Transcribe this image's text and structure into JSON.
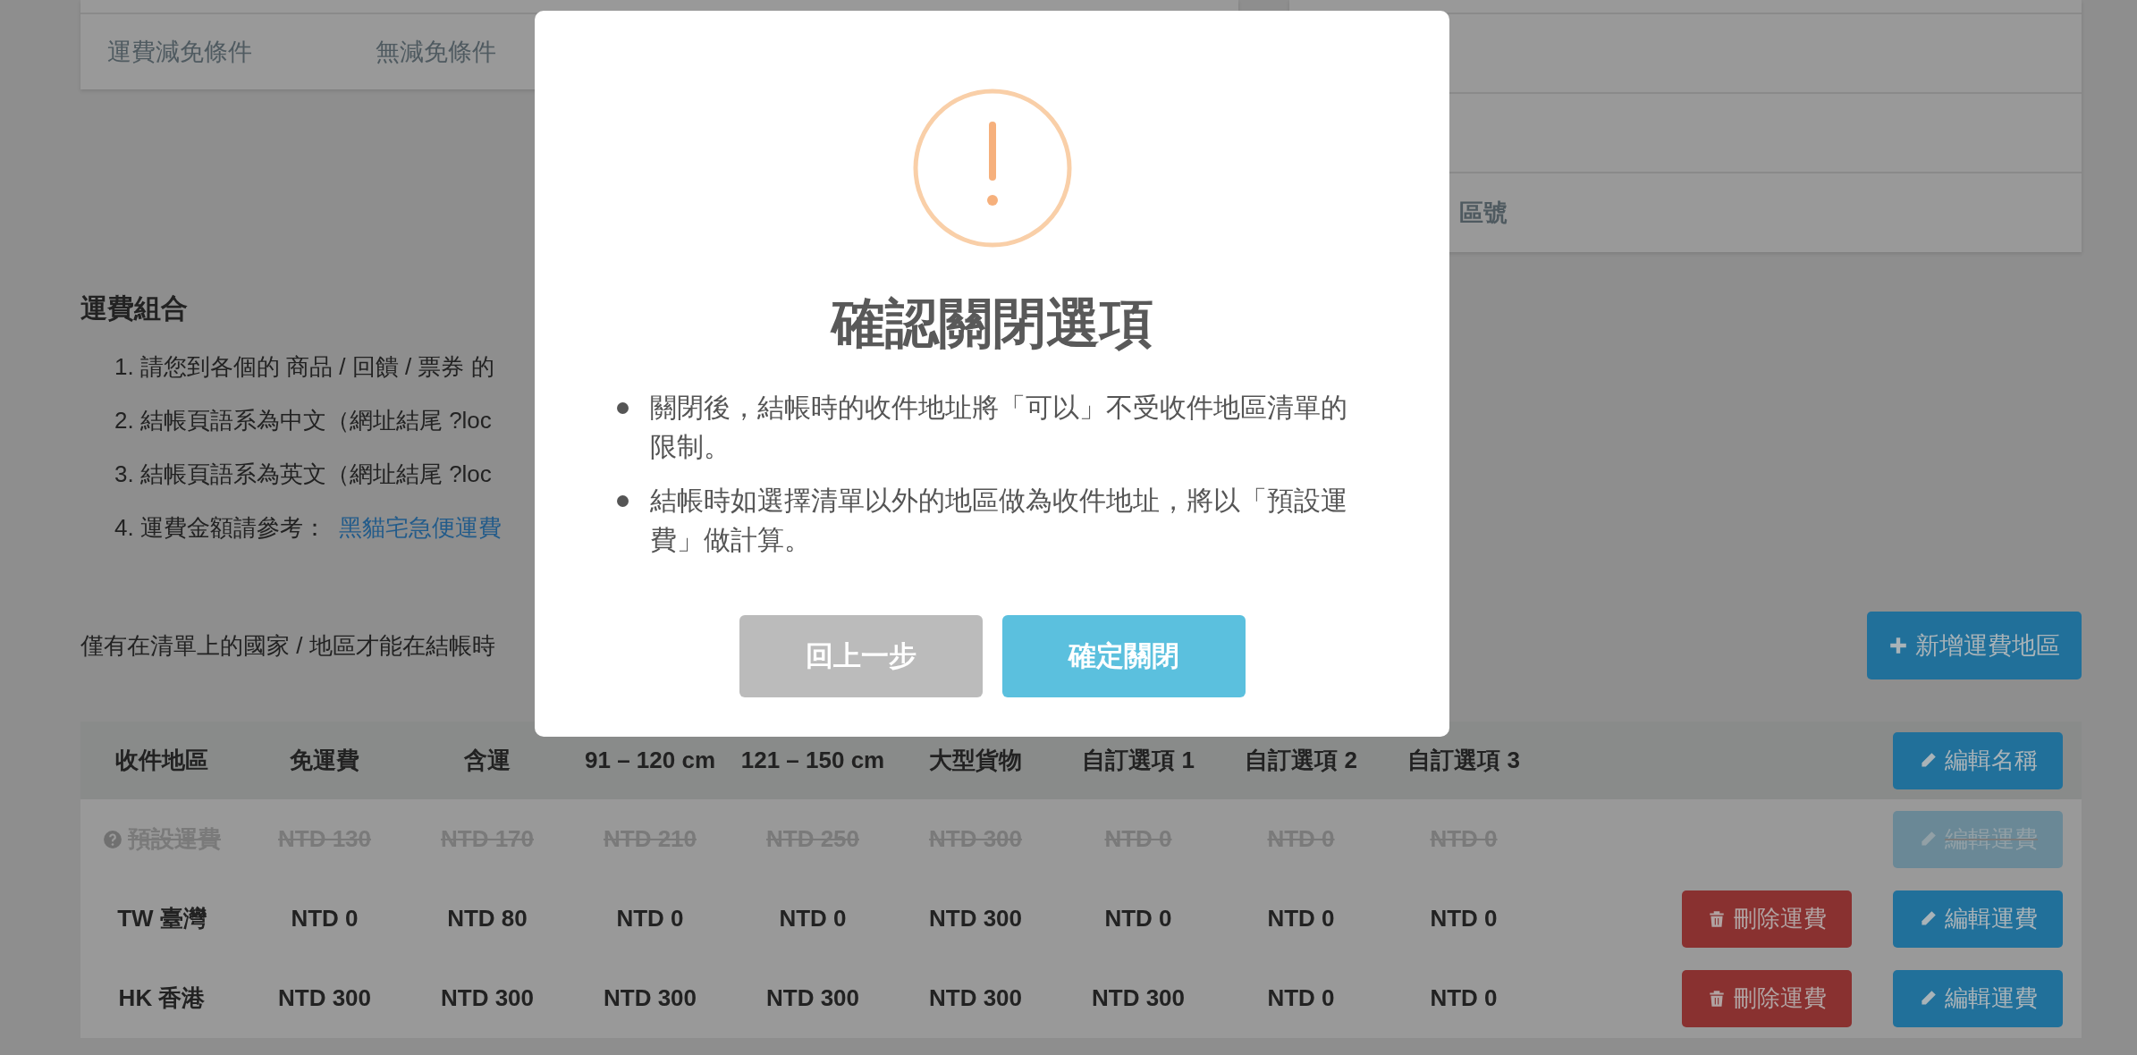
{
  "summary_card": {
    "label": "運費減免條件",
    "value": "無減免條件"
  },
  "side_card": {
    "rows": [
      "",
      "",
      "區號"
    ]
  },
  "section": {
    "title": "運費組合",
    "items": [
      {
        "text": "1. 請您到各個的 商品 / 回饋 / 票券 的"
      },
      {
        "text": "2. 結帳頁語系為中文（網址結尾 ?loc"
      },
      {
        "text": "3. 結帳頁語系為英文（網址結尾 ?loc"
      },
      {
        "text": "4. 運費金額請參考：",
        "link": "黑貓宅急便運費"
      }
    ]
  },
  "note": "僅有在清單上的國家 / 地區才能在結帳時",
  "add_button": "新增運費地區",
  "table": {
    "columns": [
      "收件地區",
      "免運費",
      "含運",
      "91 – 120 cm",
      "121 – 150 cm",
      "大型貨物",
      "自訂選項 1",
      "自訂選項 2",
      "自訂選項 3"
    ],
    "rename_button": "編輯名稱",
    "rows": [
      {
        "kind": "default",
        "region": "預設運費",
        "values": [
          "NTD 130",
          "NTD 170",
          "NTD 210",
          "NTD 250",
          "NTD 300",
          "NTD 0",
          "NTD 0",
          "NTD 0"
        ],
        "edit": "編輯運費",
        "edit_disabled": true
      },
      {
        "kind": "region",
        "region": "TW 臺灣",
        "values": [
          "NTD 0",
          "NTD 80",
          "NTD 0",
          "NTD 0",
          "NTD 300",
          "NTD 0",
          "NTD 0",
          "NTD 0"
        ],
        "delete": "刪除運費",
        "edit": "編輯運費",
        "edit_disabled": false
      },
      {
        "kind": "region",
        "region": "HK 香港",
        "values": [
          "NTD 300",
          "NTD 300",
          "NTD 300",
          "NTD 300",
          "NTD 300",
          "NTD 300",
          "NTD 0",
          "NTD 0"
        ],
        "delete": "刪除運費",
        "edit": "編輯運費",
        "edit_disabled": false
      }
    ]
  },
  "dialog": {
    "title": "確認關閉選項",
    "bullets": [
      "關閉後，結帳時的收件地址將「可以」不受收件地區清單的限制。",
      "結帳時如選擇清單以外的地區做為收件地址，將以「預設運費」做計算。"
    ],
    "buttons": [
      {
        "kind": "cancel",
        "label": "回上一步"
      },
      {
        "kind": "confirm",
        "label": "確定關閉"
      }
    ]
  }
}
